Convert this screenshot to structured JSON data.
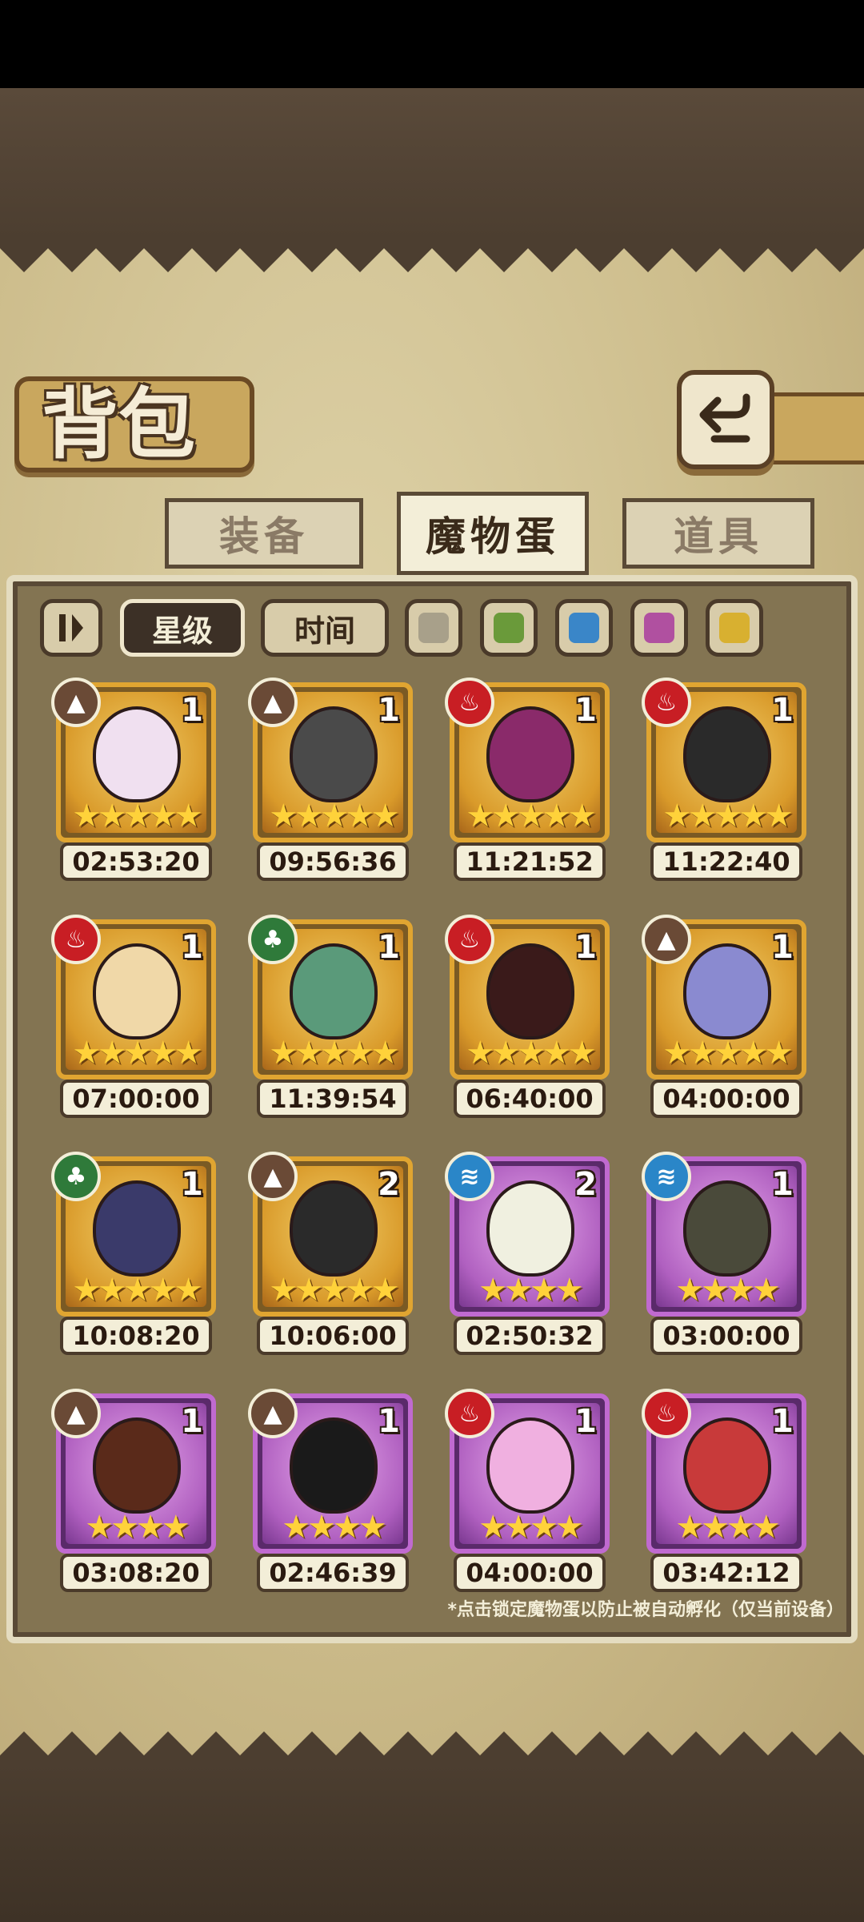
{
  "header": {
    "title": "背包"
  },
  "tabs": [
    {
      "label": "装备",
      "active": false
    },
    {
      "label": "魔物蛋",
      "active": true
    },
    {
      "label": "道具",
      "active": false
    }
  ],
  "filters": {
    "sort_order_icon": "sort-toggle-icon",
    "star_label": "星级",
    "star_selected": true,
    "time_label": "时间",
    "color_swatches": [
      "#a8a08a",
      "#6a9a3a",
      "#3a86c8",
      "#b050a0",
      "#d8b030"
    ]
  },
  "eggs": [
    {
      "element": "earth",
      "count": "1",
      "stars": "★★★★★",
      "timer": "02:53:20",
      "rarity": "gold",
      "egg_color": "#f0e0f0"
    },
    {
      "element": "earth",
      "count": "1",
      "stars": "★★★★★",
      "timer": "09:56:36",
      "rarity": "gold",
      "egg_color": "#4a4a4a"
    },
    {
      "element": "fire",
      "count": "1",
      "stars": "★★★★★",
      "timer": "11:21:52",
      "rarity": "gold",
      "egg_color": "#8a2a6a"
    },
    {
      "element": "fire",
      "count": "1",
      "stars": "★★★★★",
      "timer": "11:22:40",
      "rarity": "gold",
      "egg_color": "#2a2a2a"
    },
    {
      "element": "fire",
      "count": "1",
      "stars": "★★★★★",
      "timer": "07:00:00",
      "rarity": "gold",
      "egg_color": "#f0d8a8"
    },
    {
      "element": "nature",
      "count": "1",
      "stars": "★★★★★",
      "timer": "11:39:54",
      "rarity": "gold",
      "egg_color": "#5a9a7a"
    },
    {
      "element": "fire",
      "count": "1",
      "stars": "★★★★★",
      "timer": "06:40:00",
      "rarity": "gold",
      "egg_color": "#3a1a1a"
    },
    {
      "element": "earth",
      "count": "1",
      "stars": "★★★★★",
      "timer": "04:00:00",
      "rarity": "gold",
      "egg_color": "#8a8ad0"
    },
    {
      "element": "nature",
      "count": "1",
      "stars": "★★★★★",
      "timer": "10:08:20",
      "rarity": "gold",
      "egg_color": "#3a3a6a"
    },
    {
      "element": "earth",
      "count": "2",
      "stars": "★★★★★",
      "timer": "10:06:00",
      "rarity": "gold",
      "egg_color": "#2a2a2a"
    },
    {
      "element": "water",
      "count": "2",
      "stars": "★★★★",
      "timer": "02:50:32",
      "rarity": "purple",
      "egg_color": "#f0f0e0"
    },
    {
      "element": "water",
      "count": "1",
      "stars": "★★★★",
      "timer": "03:00:00",
      "rarity": "purple",
      "egg_color": "#4a4a3a"
    },
    {
      "element": "earth",
      "count": "1",
      "stars": "★★★★",
      "timer": "03:08:20",
      "rarity": "purple",
      "egg_color": "#5a2a1a"
    },
    {
      "element": "earth",
      "count": "1",
      "stars": "★★★★",
      "timer": "02:46:39",
      "rarity": "purple",
      "egg_color": "#1a1a1a"
    },
    {
      "element": "fire",
      "count": "1",
      "stars": "★★★★",
      "timer": "04:00:00",
      "rarity": "purple",
      "egg_color": "#f0b0e0"
    },
    {
      "element": "fire",
      "count": "1",
      "stars": "★★★★",
      "timer": "03:42:12",
      "rarity": "purple",
      "egg_color": "#c83a3a"
    }
  ],
  "footer": {
    "hint": "*点击锁定魔物蛋以防止被自动孵化（仅当前设备）"
  }
}
